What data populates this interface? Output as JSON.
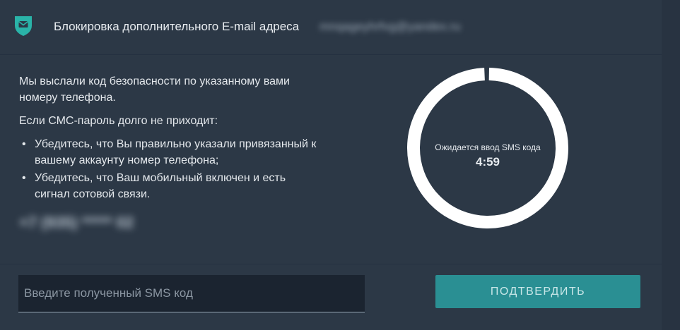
{
  "header": {
    "title": "Блокировка дополнительного E-mail адреса",
    "email_masked": "mnqageyhrfvg@yandex.ru",
    "icon": "shield-mail-icon"
  },
  "info": {
    "paragraph1": "Мы выслали код безопасности по указанному вами номеру телефона.",
    "paragraph2": "Если СМС-пароль долго не приходит:",
    "bullets": [
      "Убедитесь, что Вы правильно указали привязанный к вашему аккаунту номер телефона;",
      "Убедитесь, что Ваш мобильный включен и есть сигнал сотовой связи."
    ]
  },
  "phone_masked": "+7 (935) ***** 02",
  "timer": {
    "label": "Ожидается ввод SMS кода",
    "value": "4:59",
    "progress": 0.99
  },
  "code_input": {
    "placeholder": "Введите полученный SMS код",
    "value": ""
  },
  "confirm_button": {
    "label": "ПОДТВЕРДИТЬ"
  },
  "colors": {
    "background": "#2c3846",
    "accent": "#2a8f93",
    "ring": "#ffffff"
  }
}
